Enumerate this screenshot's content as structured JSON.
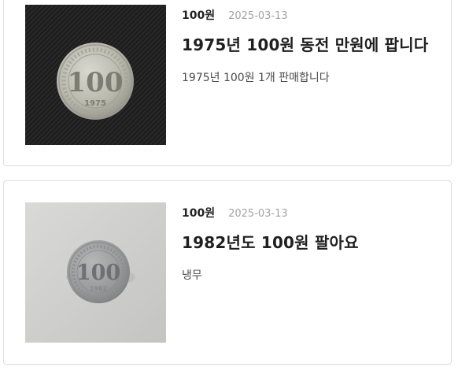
{
  "listings": [
    {
      "category": "100원",
      "date": "2025-03-13",
      "title": "1975년 100원 동전 만원에 팝니다",
      "description": "1975년 100원 1개 판매합니다",
      "coin_text": "100",
      "coin_year": "1975"
    },
    {
      "category": "100원",
      "date": "2025-03-13",
      "title": "1982년도 100원 팔아요",
      "description": "냉무",
      "coin_text": "100",
      "coin_year": "1982"
    }
  ],
  "colors": {
    "card_border": "#dcdcdc",
    "date_text": "#a3a3a3",
    "title_text": "#1f1f1f"
  }
}
